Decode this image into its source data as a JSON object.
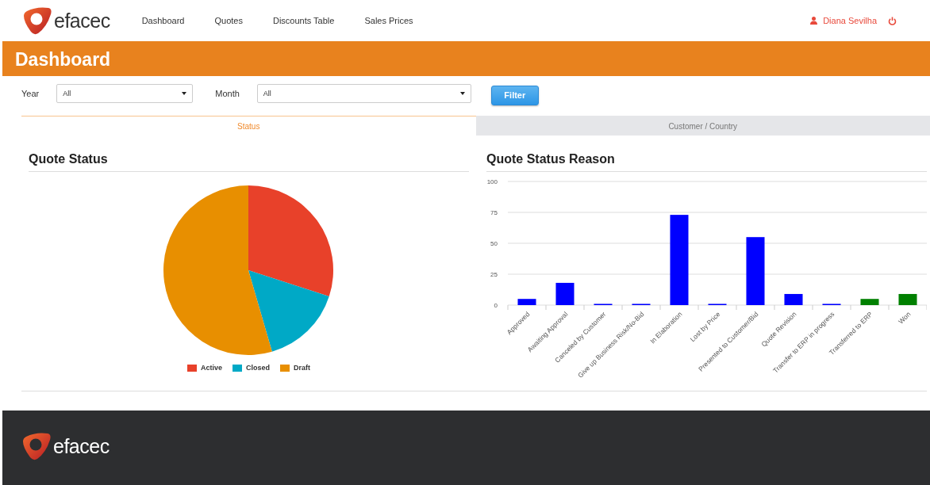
{
  "header": {
    "logo_text": "efacec",
    "nav": [
      "Dashboard",
      "Quotes",
      "Discounts Table",
      "Sales Prices"
    ],
    "user": "Diana Sevilha"
  },
  "banner": {
    "title": "Dashboard"
  },
  "filters": [
    {
      "label": "Year",
      "value": "All"
    },
    {
      "label": "Month",
      "value": "All"
    }
  ],
  "filter_button": "Filter",
  "tabs": [
    {
      "label": "Status",
      "selected": true
    },
    {
      "label": "Customer / Country",
      "selected": false
    }
  ],
  "quote_status": {
    "title": "Quote Status",
    "legend": [
      {
        "label": "Active",
        "color": "#e8412a"
      },
      {
        "label": "Closed",
        "color": "#00a9c6"
      },
      {
        "label": "Draft",
        "color": "#e88f00"
      }
    ]
  },
  "quote_status_reason": {
    "title": "Quote Status Reason",
    "chart_data": {
      "type": "bar",
      "grid": true,
      "categories": [
        "Approved",
        "Awaiting Approval",
        "Canceled by Customer",
        "Give up Business Risk/No-Bid",
        "In Elaboration",
        "Lost by Price",
        "Presented to Customer/Bid",
        "Quote Revision",
        "Transfer to ERP in progress",
        "Transferred to ERP",
        "Won"
      ],
      "ylim": [
        0,
        100
      ],
      "yticks": [
        0,
        25,
        50,
        75,
        100
      ],
      "series": [
        {
          "color": "#0000ff",
          "values": [
            5,
            18,
            1,
            1,
            73,
            1,
            55,
            9,
            1,
            null,
            null
          ]
        },
        {
          "color": "#008000",
          "values": [
            null,
            null,
            null,
            null,
            null,
            null,
            null,
            null,
            null,
            5,
            9
          ]
        }
      ]
    }
  },
  "footer": {
    "logo_text": "efacec"
  }
}
